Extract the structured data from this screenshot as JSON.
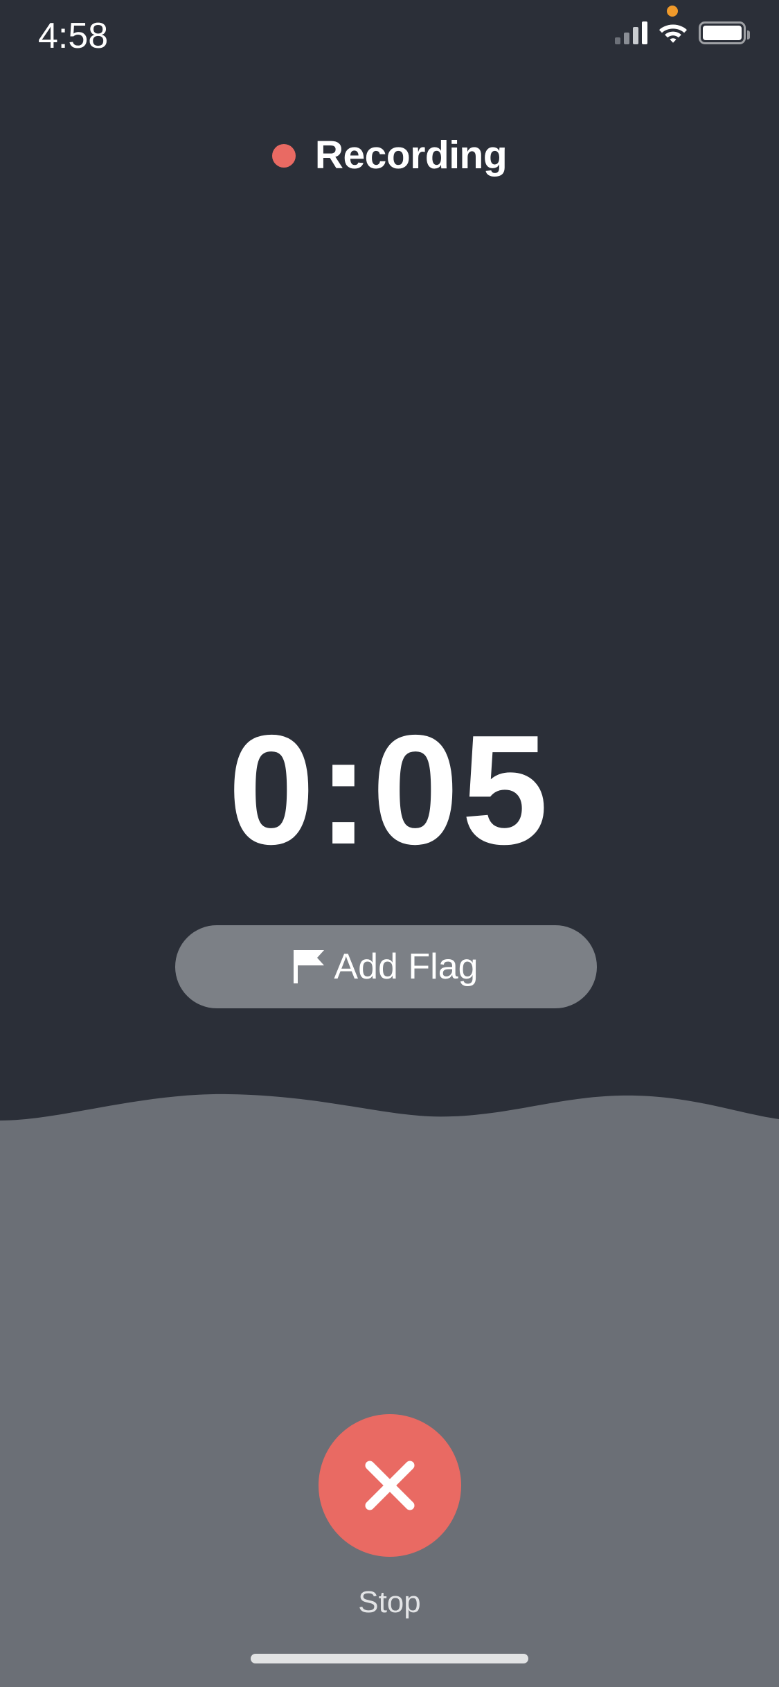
{
  "status_bar": {
    "time": "4:58",
    "recording_indicator_icon": "orange-dot-icon",
    "recording_indicator_color": "#f09a2b",
    "signal_icon": "cellular-signal-icon",
    "signal_bars_filled": 3,
    "signal_bars_total": 4,
    "wifi_icon": "wifi-icon",
    "battery_icon": "battery-full-icon"
  },
  "header": {
    "status_dot_icon": "red-dot-icon",
    "title": "Recording",
    "accent_color": "#e96a63"
  },
  "timer": {
    "value": "0:05",
    "minutes": "0",
    "separator": ":",
    "seconds": "05"
  },
  "add_flag": {
    "label": "Add Flag",
    "icon": "flag-icon",
    "background_color": "#7c8086",
    "text_color": "#ffffff"
  },
  "lower_panel": {
    "background_color": "#6b6f76",
    "divider_shape": "wave-divider"
  },
  "stop": {
    "label": "Stop",
    "icon": "close-x-icon",
    "button_color": "#e96a63",
    "icon_color": "#ffffff"
  },
  "home_indicator": {
    "name": "home-indicator"
  },
  "theme": {
    "background_color": "#2b2f38",
    "accent_color": "#e96a63",
    "muted_color": "#6b6f76"
  }
}
